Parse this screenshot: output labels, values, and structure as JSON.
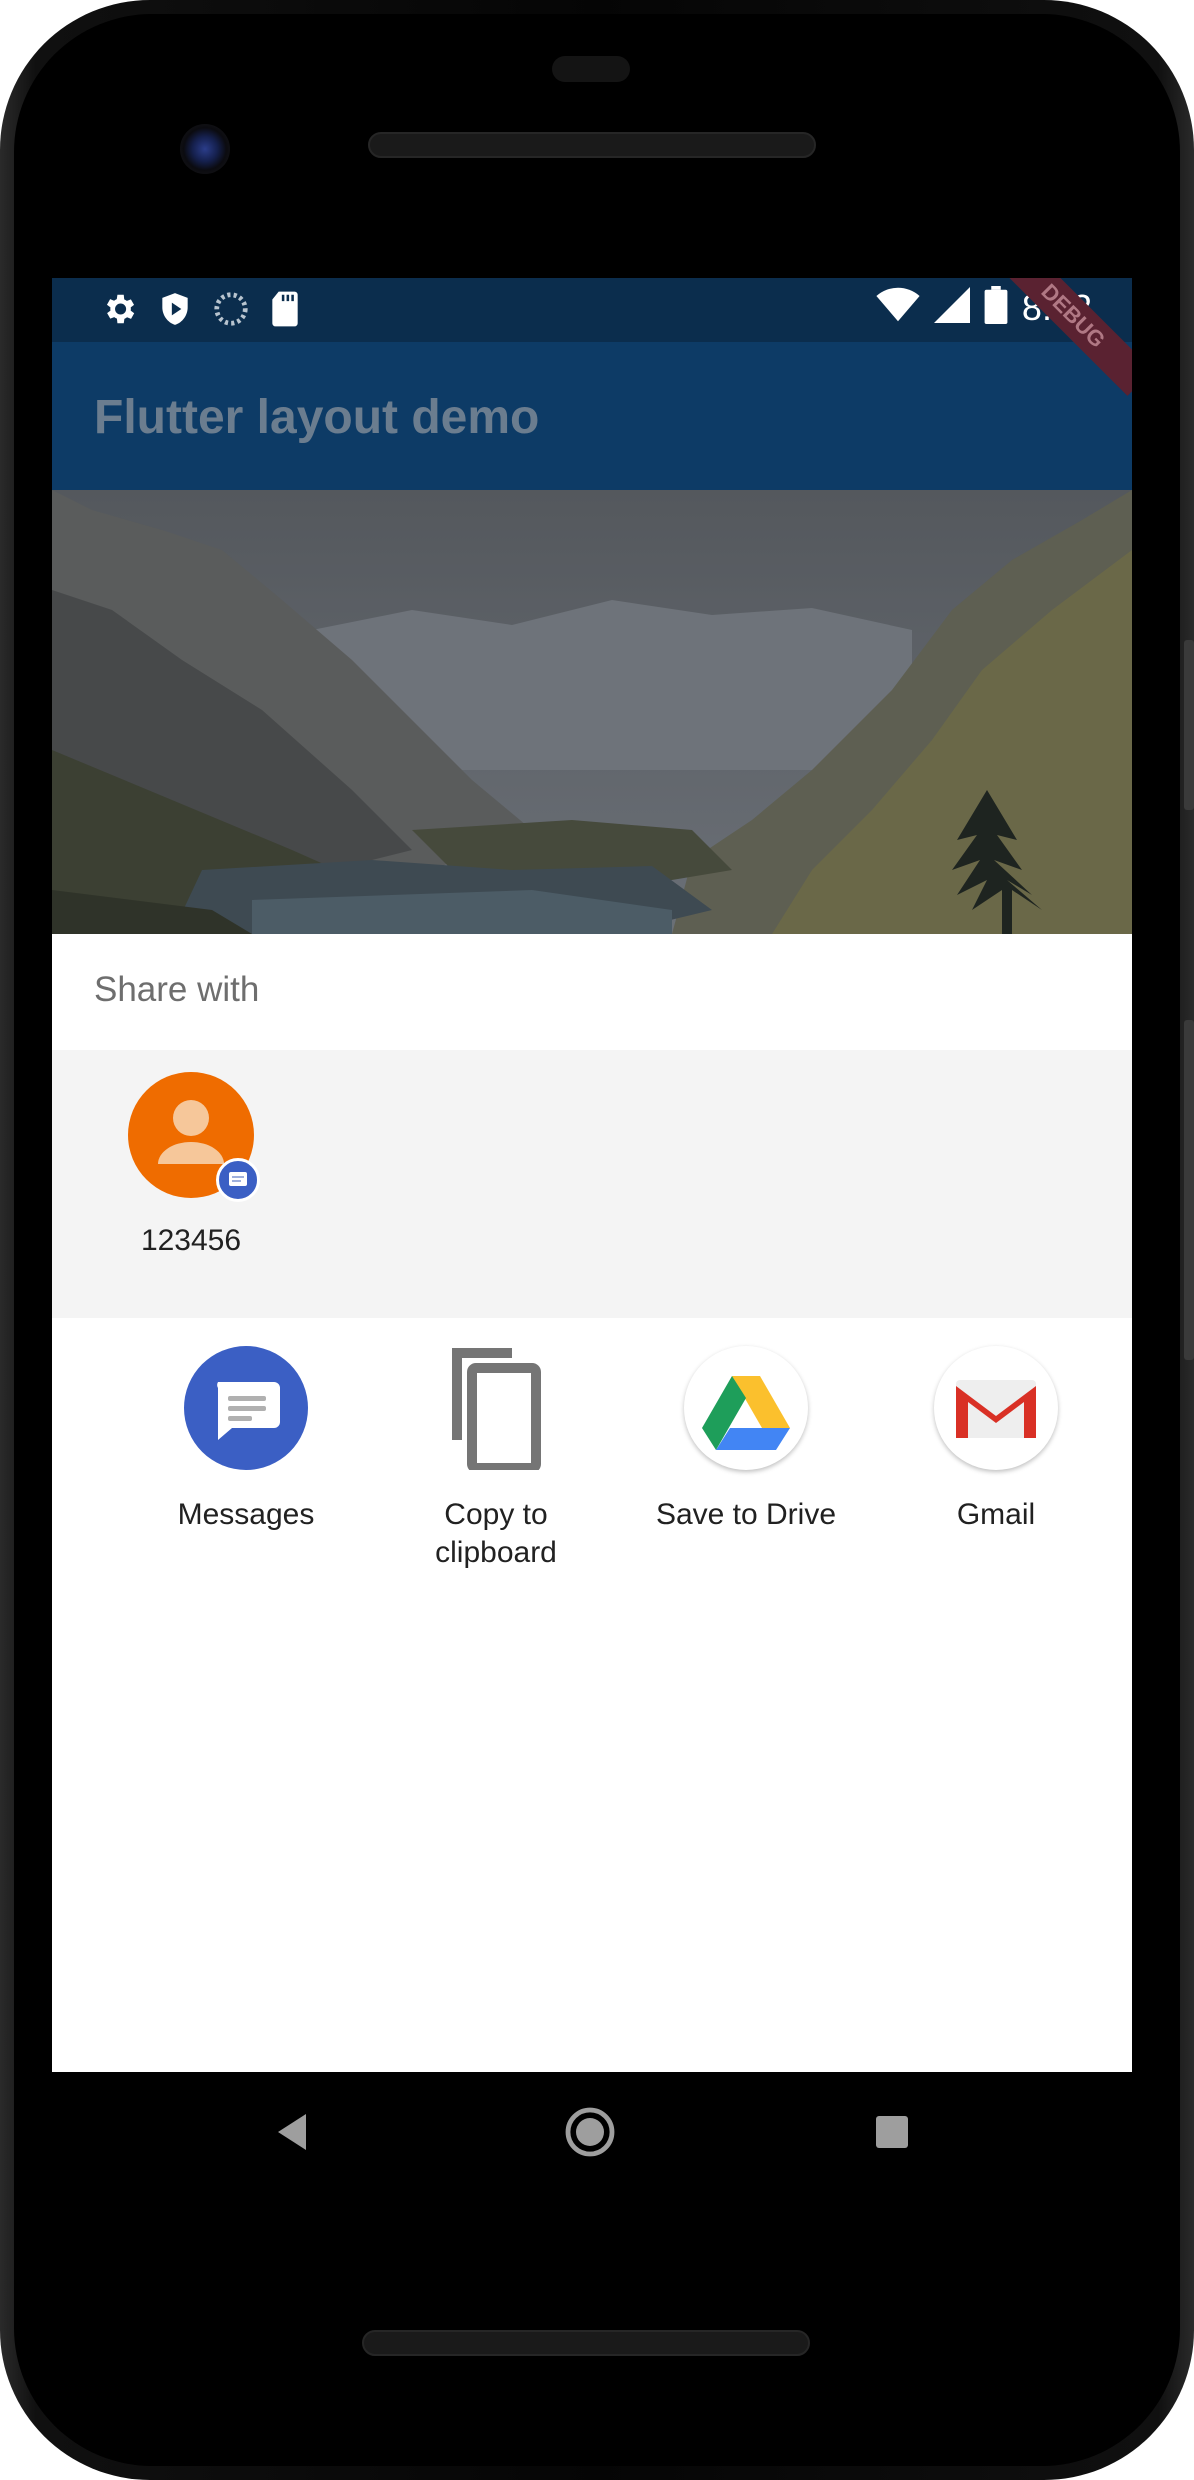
{
  "status_bar": {
    "time": "8:22",
    "left_icons": [
      "settings-icon",
      "shield-play-icon",
      "loading-icon",
      "sd-card-icon"
    ],
    "right_icons": [
      "wifi-icon",
      "cell-signal-icon",
      "battery-icon"
    ]
  },
  "app_bar": {
    "title": "Flutter layout demo",
    "debug_banner": "DEBUG"
  },
  "share_sheet": {
    "title": "Share with",
    "direct_share": [
      {
        "label": "123456",
        "icon": "contact-avatar-icon",
        "badge": "messages-badge-icon"
      }
    ],
    "apps": [
      {
        "label": "Messages",
        "icon": "messages-icon"
      },
      {
        "label": "Copy to clipboard",
        "icon": "copy-icon"
      },
      {
        "label": "Save to Drive",
        "icon": "google-drive-icon"
      },
      {
        "label": "Gmail",
        "icon": "gmail-icon"
      }
    ]
  },
  "nav_bar": {
    "buttons": [
      "back-icon",
      "home-icon",
      "recents-icon"
    ]
  },
  "colors": {
    "app_bar": "#0d3b66",
    "status_bar": "#0b2d4d",
    "contact_avatar": "#ef6c00",
    "messages_blue": "#3b5fc4"
  }
}
